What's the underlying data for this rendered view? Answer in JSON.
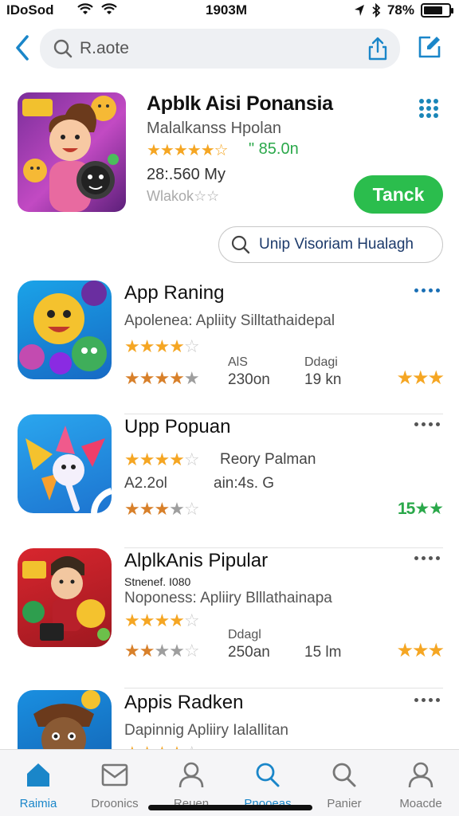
{
  "status": {
    "carrier": "IDoSod",
    "time": "1903M",
    "battery": "78%",
    "battery_level": 0.78
  },
  "search": {
    "query": "R.aote"
  },
  "featured": {
    "title": "Apblk Aisi Ponansia",
    "subtitle": "Malalkanss Hpolan",
    "stars": "★★★★★☆",
    "price": "\" 85.0n",
    "size": "28:.560 My",
    "meta": "Wlakok☆☆",
    "action": "Tanck",
    "search_pill": "Unip Visoriam Hualagh"
  },
  "items": [
    {
      "title": "App Raning",
      "sub": "Apolenea: Apliity Silltathaidepal",
      "col1_label": "AlS",
      "col1_value": "230on",
      "col2_label": "Ddagi",
      "col2_value": "19 kn"
    },
    {
      "title": "Upp Popuan",
      "sub2": "Reory Palman",
      "col1_value": "A2.2ol",
      "col2_value": "ain:4s. G",
      "right_score": "15★★"
    },
    {
      "title": "AlplkAnis Pipular",
      "tag": "Stnenef. I080",
      "sub": "Noponess: Apliiry Blllathainapa",
      "col2_label": "Ddagl",
      "col1_value": "250an",
      "col2_value": "15 lm"
    },
    {
      "title": "Appis Radken",
      "sub": "Dapinnig Apliiry Ialallitan"
    }
  ],
  "tabs": [
    {
      "label": "Raimia",
      "icon": "home-icon",
      "active": true
    },
    {
      "label": "Droonics",
      "icon": "inbox-icon",
      "active": false
    },
    {
      "label": "Reuen",
      "icon": "person-icon",
      "active": false
    },
    {
      "label": "Pnooeas",
      "icon": "search-icon",
      "active": true
    },
    {
      "label": "Panier",
      "icon": "search-icon",
      "active": false
    },
    {
      "label": "Moacde",
      "icon": "person-icon",
      "active": false
    }
  ],
  "colors": {
    "accent": "#1a86c9",
    "install": "#2bbd4d",
    "star": "#f5a623"
  }
}
